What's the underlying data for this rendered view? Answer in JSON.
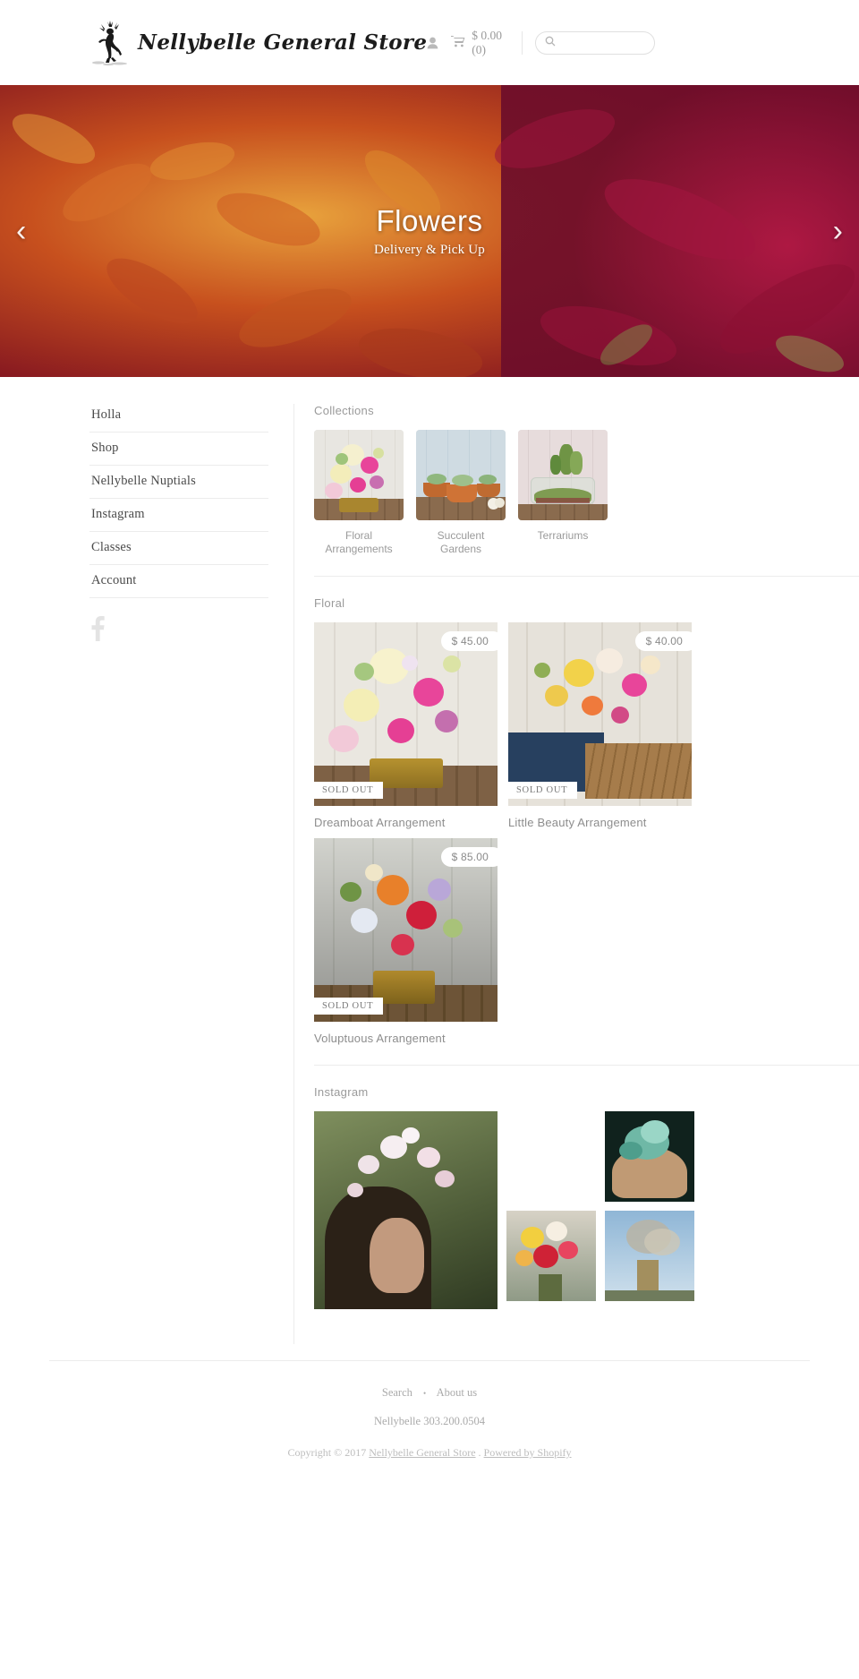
{
  "header": {
    "logo_text": "Nellybelle General Store",
    "logo_icon": "jackalope-logo-icon",
    "account_icon": "user-icon",
    "cart_icon": "cart-icon",
    "cart_label": "$ 0.00 (0)",
    "search_icon": "search-icon",
    "search_placeholder": "",
    "search_value": ""
  },
  "hero": {
    "title": "Flowers",
    "subtitle": "Delivery & Pick Up",
    "prev_icon": "chevron-left-icon",
    "next_icon": "chevron-right-icon"
  },
  "sidebar": {
    "items": [
      {
        "label": "Holla"
      },
      {
        "label": "Shop"
      },
      {
        "label": "Nellybelle Nuptials"
      },
      {
        "label": "Instagram"
      },
      {
        "label": "Classes"
      },
      {
        "label": "Account"
      }
    ],
    "social": [
      {
        "icon": "facebook-icon",
        "label": "Facebook"
      }
    ]
  },
  "collections": {
    "heading": "Collections",
    "items": [
      {
        "name": "Floral Arrangements",
        "image": "floral-arrangement-thumb"
      },
      {
        "name": "Succulent Gardens",
        "image": "succulent-gardens-thumb"
      },
      {
        "name": "Terrariums",
        "image": "terrariums-thumb"
      }
    ]
  },
  "floral": {
    "heading": "Floral",
    "products": [
      {
        "title": "Dreamboat Arrangement",
        "price": "$ 45.00",
        "badge": "SOLD OUT",
        "image": "dreamboat-arrangement-photo"
      },
      {
        "title": "Little Beauty Arrangement",
        "price": "$ 40.00",
        "badge": "SOLD OUT",
        "image": "little-beauty-arrangement-photo"
      },
      {
        "title": "Voluptuous Arrangement",
        "price": "$ 85.00",
        "badge": "SOLD OUT",
        "image": "voluptuous-arrangement-photo"
      }
    ]
  },
  "instagram": {
    "heading": "Instagram",
    "photos": [
      {
        "alt": "girl-with-flower-crown"
      },
      {
        "alt": "succulent-in-hand"
      },
      {
        "alt": "red-yellow-bouquet"
      },
      {
        "alt": "dried-arrangement-sky"
      }
    ]
  },
  "footer": {
    "links": [
      {
        "label": "Search"
      },
      {
        "label": "About us"
      }
    ],
    "separator": "•",
    "phone": "Nellybelle 303.200.0504",
    "copyright_prefix": "Copyright © 2017",
    "store_link": "Nellybelle General Store",
    "copyright_mid": ".",
    "shopify_link": "Powered by Shopify"
  },
  "colors": {
    "text": "#8d8d8d",
    "heading": "#9a9a9a",
    "rule": "#ececec",
    "hero_bg": "#7c1126"
  }
}
